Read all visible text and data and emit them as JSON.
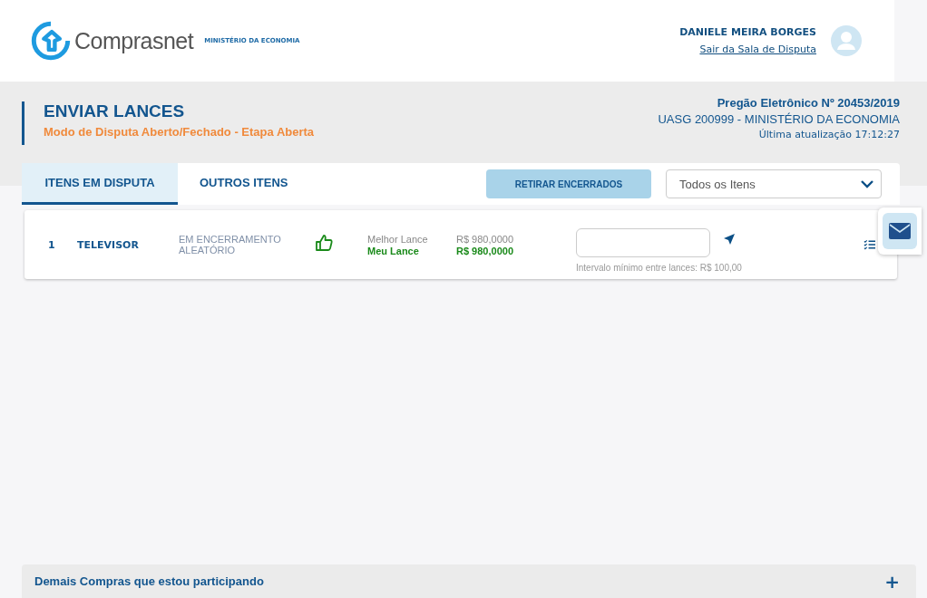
{
  "header": {
    "logo_text": "Comprasnet",
    "ministry": "MINISTÉRIO DA ECONOMIA",
    "user_name": "DANIELE MEIRA BORGES",
    "logout_link": "Sair da Sala de Disputa"
  },
  "page": {
    "title": "ENVIAR LANCES",
    "subtitle": "Modo de Disputa Aberto/Fechado - Etapa Aberta",
    "process": "Pregão Eletrônico Nº 20453/2019",
    "uasg": "UASG 200999 - MINISTÉRIO DA ECONOMIA",
    "updated": "Última atualização 17:12:27"
  },
  "tabs": [
    {
      "label": "ITENS EM DISPUTA",
      "selected": true
    },
    {
      "label": "OUTROS ITENS",
      "selected": false
    }
  ],
  "toolbar": {
    "button": "RETIRAR ENCERRADOS",
    "filter": "Todos os Itens"
  },
  "items": [
    {
      "number": "1",
      "name": "TELEVISOR",
      "status": "EM ENCERRAMENTO ALEATÓRIO",
      "winning": true,
      "best_label": "Melhor Lance",
      "best_value": "R$ 980,0000",
      "my_label": "Meu Lance",
      "my_value": "R$ 980,0000",
      "interval": "Intervalo mínimo entre lances: R$ 100,00"
    }
  ],
  "footer": {
    "label": "Demais Compras que estou participando",
    "toggle": "+"
  }
}
